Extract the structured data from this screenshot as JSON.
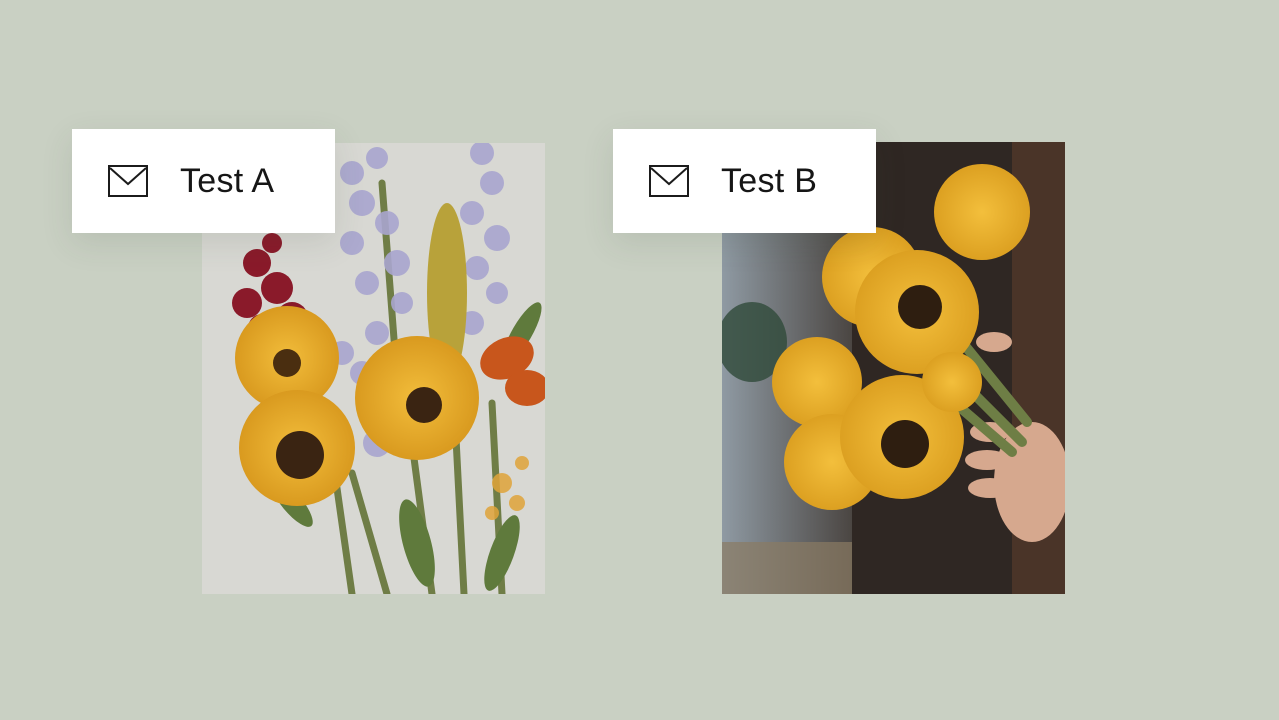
{
  "variants": [
    {
      "label": "Test A",
      "icon": "envelope-icon",
      "image": "mixed-bouquet-sunflowers-delphinium-snapdragon"
    },
    {
      "label": "Test B",
      "icon": "envelope-icon",
      "image": "hands-holding-sunflower-bouquet"
    }
  ],
  "colors": {
    "background": "#c9d0c3",
    "card_label_bg": "#ffffff",
    "text": "#161616",
    "sunflower": "#e7a82a",
    "sunflower_center": "#3a2412"
  }
}
